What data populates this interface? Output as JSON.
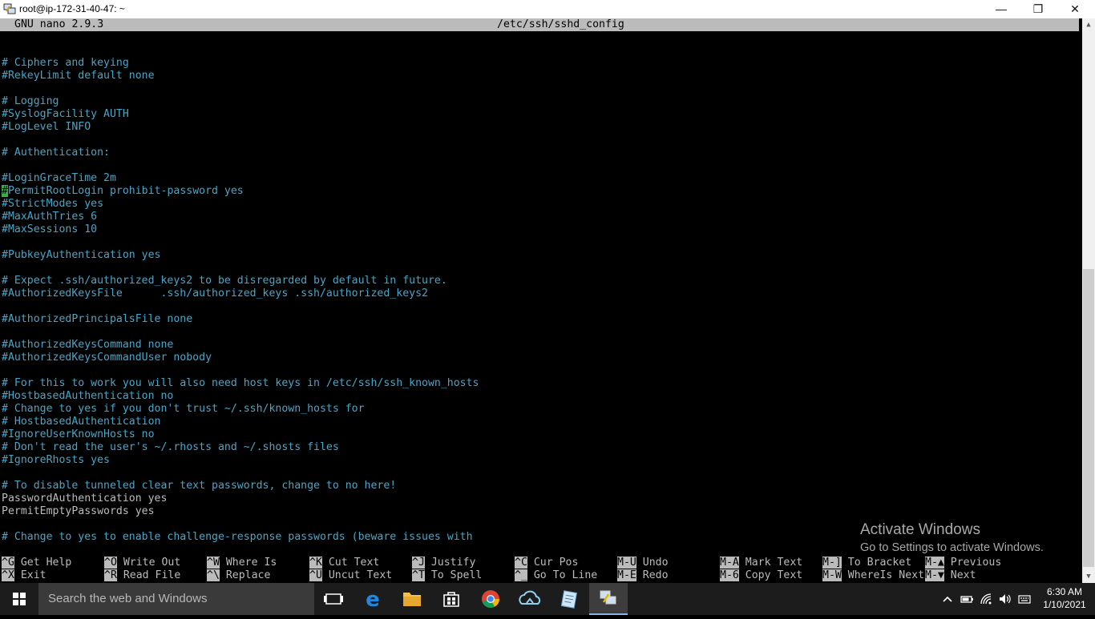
{
  "window": {
    "title": "root@ip-172-31-40-47: ~",
    "minimize": "—",
    "maximize": "❐",
    "close": "✕"
  },
  "nano": {
    "version": "GNU nano 2.9.3",
    "filename": "/etc/ssh/sshd_config"
  },
  "lines": [
    "# Ciphers and keying",
    "#RekeyLimit default none",
    "",
    "# Logging",
    "#SyslogFacility AUTH",
    "#LogLevel INFO",
    "",
    "# Authentication:",
    "",
    "#LoginGraceTime 2m",
    "#PermitRootLogin prohibit-password yes",
    "#StrictModes yes",
    "#MaxAuthTries 6",
    "#MaxSessions 10",
    "",
    "#PubkeyAuthentication yes",
    "",
    "# Expect .ssh/authorized_keys2 to be disregarded by default in future.",
    "#AuthorizedKeysFile      .ssh/authorized_keys .ssh/authorized_keys2",
    "",
    "#AuthorizedPrincipalsFile none",
    "",
    "#AuthorizedKeysCommand none",
    "#AuthorizedKeysCommandUser nobody",
    "",
    "# For this to work you will also need host keys in /etc/ssh/ssh_known_hosts",
    "#HostbasedAuthentication no",
    "# Change to yes if you don't trust ~/.ssh/known_hosts for",
    "# HostbasedAuthentication",
    "#IgnoreUserKnownHosts no",
    "# Don't read the user's ~/.rhosts and ~/.shosts files",
    "#IgnoreRhosts yes",
    "",
    "# To disable tunneled clear text passwords, change to no here!",
    "PasswordAuthentication yes",
    "PermitEmptyPasswords yes",
    "",
    "# Change to yes to enable challenge-response passwords (beware issues with"
  ],
  "cursor_line": 10,
  "shortcuts": [
    {
      "key": "^G",
      "label": "Get Help"
    },
    {
      "key": "^O",
      "label": "Write Out"
    },
    {
      "key": "^W",
      "label": "Where Is"
    },
    {
      "key": "^K",
      "label": "Cut Text"
    },
    {
      "key": "^J",
      "label": "Justify"
    },
    {
      "key": "^C",
      "label": "Cur Pos"
    },
    {
      "key": "M-U",
      "label": "Undo"
    },
    {
      "key": "M-A",
      "label": "Mark Text"
    },
    {
      "key": "M-]",
      "label": "To Bracket"
    },
    {
      "key": "M-▲",
      "label": "Previous"
    },
    {
      "key": "^X",
      "label": "Exit"
    },
    {
      "key": "^R",
      "label": "Read File"
    },
    {
      "key": "^\\",
      "label": "Replace"
    },
    {
      "key": "^U",
      "label": "Uncut Text"
    },
    {
      "key": "^T",
      "label": "To Spell"
    },
    {
      "key": "^_",
      "label": "Go To Line"
    },
    {
      "key": "M-E",
      "label": "Redo"
    },
    {
      "key": "M-6",
      "label": "Copy Text"
    },
    {
      "key": "M-W",
      "label": "WhereIs Next"
    },
    {
      "key": "M-▼",
      "label": "Next"
    }
  ],
  "watermark": {
    "title": "Activate Windows",
    "subtitle": "Go to Settings to activate Windows."
  },
  "taskbar": {
    "search_placeholder": "Search the web and Windows",
    "pinned": [
      "task-view-icon",
      "edge-icon",
      "file-explorer-icon",
      "store-icon",
      "chrome-icon",
      "cloud-app-icon",
      "notepad-icon",
      "putty-icon"
    ],
    "time": "6:30 AM",
    "date": "1/10/2021"
  },
  "colors": {
    "comment": "#46a6c8",
    "text": "#bbbbbb",
    "cursor": "#37b04c",
    "statusbar": "#bbbbbb",
    "taskbar": "#1c1c1c"
  }
}
